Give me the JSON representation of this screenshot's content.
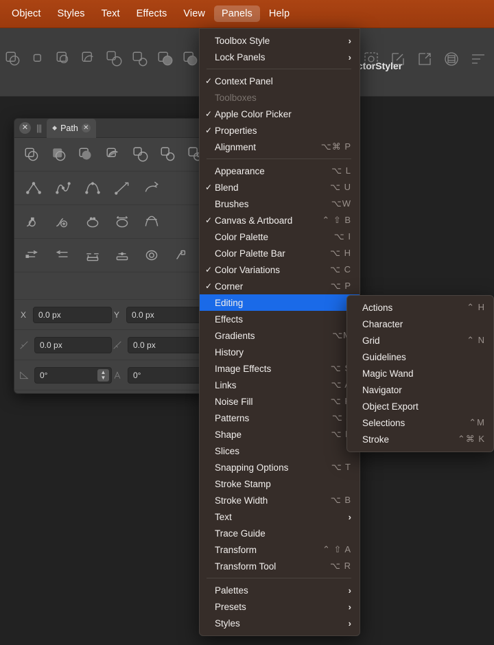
{
  "colors": {
    "menubar": "#a33d11",
    "menu_bg": "#362d29",
    "highlight": "#1a6ae8",
    "toolbar": "#3d3d3d",
    "canvas": "#222222",
    "panel": "#414141"
  },
  "menubar": {
    "items": [
      {
        "label": "Object",
        "active": false
      },
      {
        "label": "Styles",
        "active": false
      },
      {
        "label": "Text",
        "active": false
      },
      {
        "label": "Effects",
        "active": false
      },
      {
        "label": "View",
        "active": false
      },
      {
        "label": "Panels",
        "active": true
      },
      {
        "label": "Help",
        "active": false
      }
    ]
  },
  "toolbar": {
    "document_title": "ectorStyler",
    "left_icons": [
      "shape-union-icon",
      "shape-small-icon",
      "shape-intersect-icon",
      "shape-subtract-icon",
      "shape-group-icon",
      "shape-exclude-icon",
      "shape-merge-icon",
      "shape-divide-icon",
      "shape-trim-icon"
    ],
    "right_icons": [
      "selection-mask-icon",
      "edit-square-icon",
      "export-square-icon",
      "grid-circle-icon",
      "align-list-icon"
    ]
  },
  "panel": {
    "title": "Path",
    "close_label": "✕",
    "tab_close_label": "✕",
    "grip_label": "|||",
    "icon_rows": [
      [
        "path-union-icon",
        "path-front-minus-icon",
        "path-back-minus-icon",
        "path-intersect-icon",
        "path-exclude-icon",
        "path-divide-icon",
        "path-outline-icon"
      ],
      [
        "node-corner-icon",
        "node-smooth-icon",
        "node-symmetric-icon",
        "node-line-icon",
        "node-curve-icon"
      ],
      [
        "node-cusp-icon",
        "node-add-icon",
        "node-close-icon",
        "node-open-icon",
        "node-join-icon"
      ],
      [
        "arrange-forward-icon",
        "arrange-backward-icon",
        "distribute-horizontal-icon",
        "distribute-vertical-icon",
        "reverse-path-icon",
        "simplify-path-icon"
      ]
    ],
    "fields": [
      {
        "label": "X",
        "icon": "x-coordinate-icon",
        "value": "0.0 px",
        "label2": "Y",
        "icon2": "y-coordinate-icon",
        "value2": "0.0 px",
        "stepper": false
      },
      {
        "label": "",
        "icon": "handle-in-icon",
        "value": "0.0 px",
        "label2": "",
        "icon2": "handle-out-icon",
        "value2": "0.0 px",
        "stepper": false
      },
      {
        "label": "",
        "icon": "angle-in-icon",
        "value": "0°",
        "label2": "",
        "icon2": "angle-out-icon",
        "value2": "0°",
        "stepper": true
      }
    ]
  },
  "menu": {
    "items": [
      {
        "checked": false,
        "label": "Toolbox Style",
        "shortcut": "",
        "arrow": true,
        "disabled": false,
        "selected": false
      },
      {
        "checked": false,
        "label": "Lock Panels",
        "shortcut": "",
        "arrow": true,
        "disabled": false,
        "selected": false
      },
      {
        "separator": true
      },
      {
        "checked": true,
        "label": "Context Panel",
        "shortcut": "",
        "arrow": false,
        "disabled": false,
        "selected": false
      },
      {
        "checked": false,
        "label": "Toolboxes",
        "shortcut": "",
        "arrow": false,
        "disabled": true,
        "selected": false
      },
      {
        "checked": true,
        "label": "Apple Color Picker",
        "shortcut": "",
        "arrow": false,
        "disabled": false,
        "selected": false
      },
      {
        "checked": true,
        "label": "Properties",
        "shortcut": "",
        "arrow": false,
        "disabled": false,
        "selected": false
      },
      {
        "checked": false,
        "label": "Alignment",
        "shortcut": "⌥⌘ P",
        "arrow": false,
        "disabled": false,
        "selected": false
      },
      {
        "separator": true
      },
      {
        "checked": false,
        "label": "Appearance",
        "shortcut": "⌥ L",
        "arrow": false,
        "disabled": false,
        "selected": false
      },
      {
        "checked": true,
        "label": "Blend",
        "shortcut": "⌥ U",
        "arrow": false,
        "disabled": false,
        "selected": false
      },
      {
        "checked": false,
        "label": "Brushes",
        "shortcut": "⌥W",
        "arrow": false,
        "disabled": false,
        "selected": false
      },
      {
        "checked": true,
        "label": "Canvas & Artboard",
        "shortcut": "⌃ ⇧ B",
        "arrow": false,
        "disabled": false,
        "selected": false
      },
      {
        "checked": false,
        "label": "Color Palette",
        "shortcut": "⌥ I",
        "arrow": false,
        "disabled": false,
        "selected": false
      },
      {
        "checked": false,
        "label": "Color Palette Bar",
        "shortcut": "⌥ H",
        "arrow": false,
        "disabled": false,
        "selected": false
      },
      {
        "checked": true,
        "label": "Color Variations",
        "shortcut": "⌥ C",
        "arrow": false,
        "disabled": false,
        "selected": false
      },
      {
        "checked": true,
        "label": "Corner",
        "shortcut": "⌥ P",
        "arrow": false,
        "disabled": false,
        "selected": false
      },
      {
        "checked": false,
        "label": "Editing",
        "shortcut": "",
        "arrow": true,
        "disabled": false,
        "selected": true
      },
      {
        "checked": false,
        "label": "Effects",
        "shortcut": "",
        "arrow": true,
        "disabled": false,
        "selected": false
      },
      {
        "checked": false,
        "label": "Gradients",
        "shortcut": "⌥M",
        "arrow": false,
        "disabled": false,
        "selected": false
      },
      {
        "checked": false,
        "label": "History",
        "shortcut": "",
        "arrow": false,
        "disabled": false,
        "selected": false
      },
      {
        "checked": false,
        "label": "Image Effects",
        "shortcut": "⌥ S",
        "arrow": false,
        "disabled": false,
        "selected": false
      },
      {
        "checked": false,
        "label": "Links",
        "shortcut": "⌥ A",
        "arrow": false,
        "disabled": false,
        "selected": false
      },
      {
        "checked": false,
        "label": "Noise Fill",
        "shortcut": "⌥ K",
        "arrow": false,
        "disabled": false,
        "selected": false
      },
      {
        "checked": false,
        "label": "Patterns",
        "shortcut": "⌥ J",
        "arrow": false,
        "disabled": false,
        "selected": false
      },
      {
        "checked": false,
        "label": "Shape",
        "shortcut": "⌥ F",
        "arrow": false,
        "disabled": false,
        "selected": false
      },
      {
        "checked": false,
        "label": "Slices",
        "shortcut": "",
        "arrow": false,
        "disabled": false,
        "selected": false
      },
      {
        "checked": false,
        "label": "Snapping Options",
        "shortcut": "⌥ T",
        "arrow": false,
        "disabled": false,
        "selected": false
      },
      {
        "checked": false,
        "label": "Stroke Stamp",
        "shortcut": "",
        "arrow": false,
        "disabled": false,
        "selected": false
      },
      {
        "checked": false,
        "label": "Stroke Width",
        "shortcut": "⌥ B",
        "arrow": false,
        "disabled": false,
        "selected": false
      },
      {
        "checked": false,
        "label": "Text",
        "shortcut": "",
        "arrow": true,
        "disabled": false,
        "selected": false
      },
      {
        "checked": false,
        "label": "Trace Guide",
        "shortcut": "",
        "arrow": false,
        "disabled": false,
        "selected": false
      },
      {
        "checked": false,
        "label": "Transform",
        "shortcut": "⌃ ⇧ A",
        "arrow": false,
        "disabled": false,
        "selected": false
      },
      {
        "checked": false,
        "label": "Transform Tool",
        "shortcut": "⌥ R",
        "arrow": false,
        "disabled": false,
        "selected": false
      },
      {
        "separator": true
      },
      {
        "checked": false,
        "label": "Palettes",
        "shortcut": "",
        "arrow": true,
        "disabled": false,
        "selected": false
      },
      {
        "checked": false,
        "label": "Presets",
        "shortcut": "",
        "arrow": true,
        "disabled": false,
        "selected": false
      },
      {
        "checked": false,
        "label": "Styles",
        "shortcut": "",
        "arrow": true,
        "disabled": false,
        "selected": false
      }
    ]
  },
  "submenu": {
    "parent": "Editing",
    "items": [
      {
        "label": "Actions",
        "shortcut": "⌃ H"
      },
      {
        "label": "Character",
        "shortcut": ""
      },
      {
        "label": "Grid",
        "shortcut": "⌃ N"
      },
      {
        "label": "Guidelines",
        "shortcut": ""
      },
      {
        "label": "Magic Wand",
        "shortcut": ""
      },
      {
        "label": "Navigator",
        "shortcut": ""
      },
      {
        "label": "Object Export",
        "shortcut": ""
      },
      {
        "label": "Selections",
        "shortcut": "⌃M"
      },
      {
        "label": "Stroke",
        "shortcut": "⌃⌘ K"
      }
    ]
  }
}
